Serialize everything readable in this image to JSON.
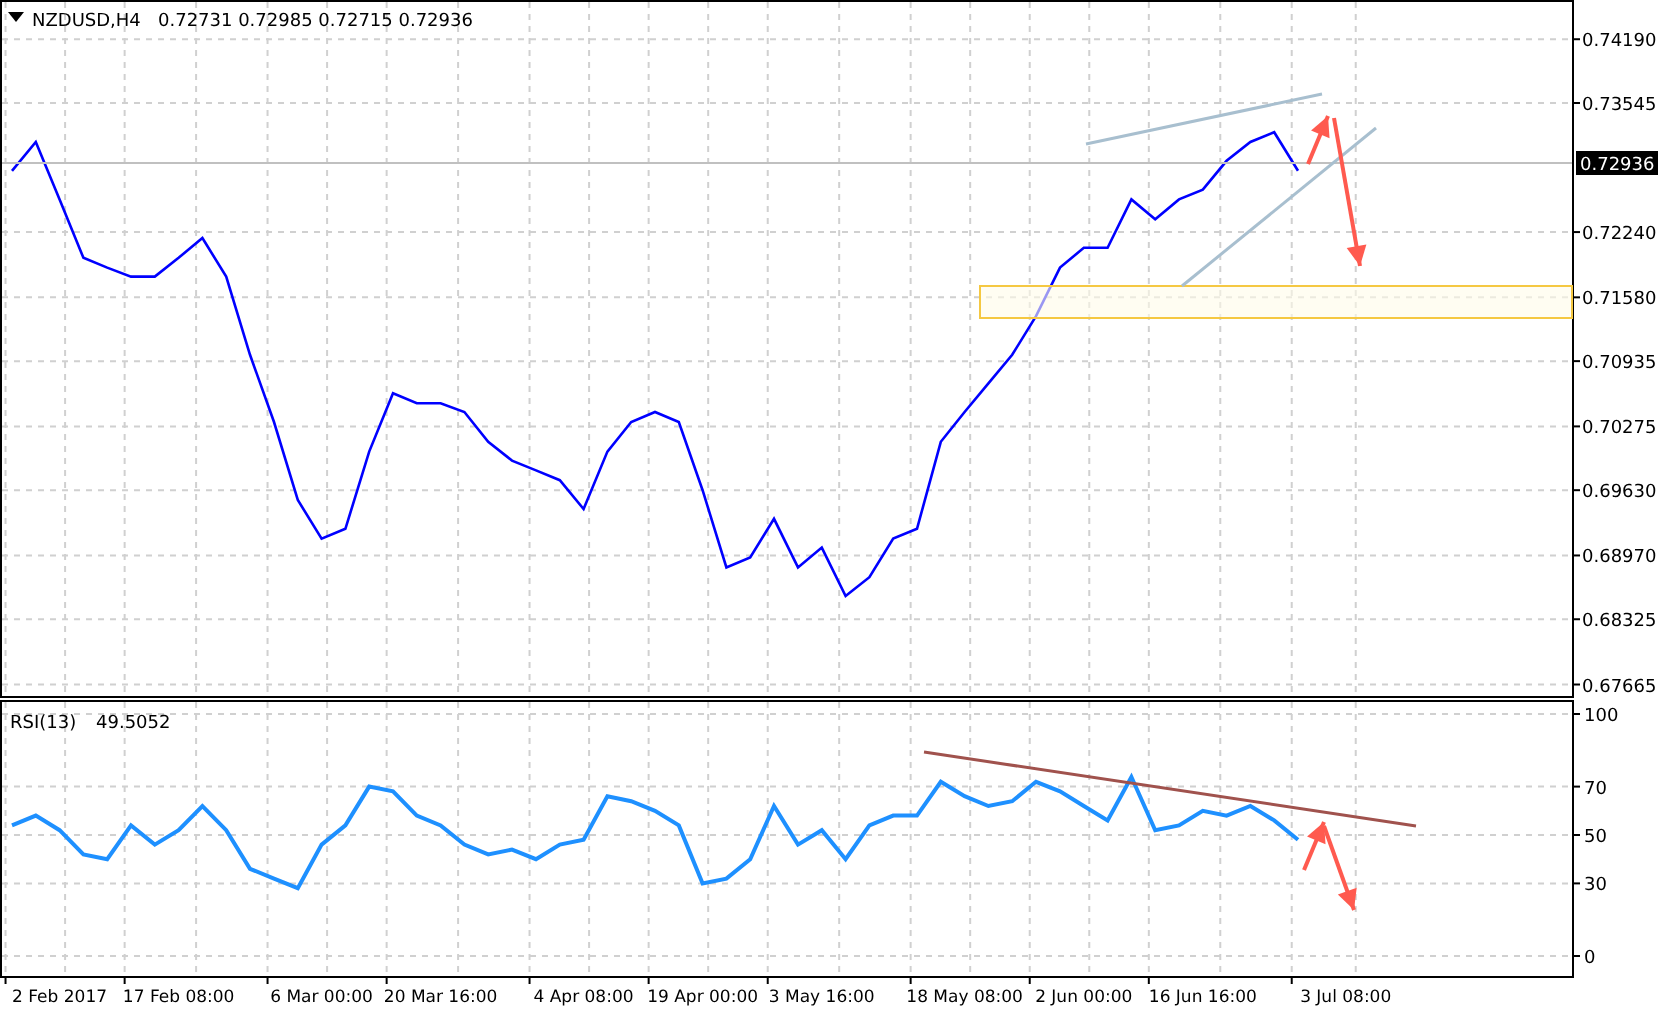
{
  "chart": {
    "ohlc": "0.72731 0.72985 0.72715 0.72936",
    "current_price": "0.72936",
    "chart_data": {
      "type": "line",
      "grid": true,
      "ylim": [
        0.6765,
        0.74526
      ],
      "yticks": [
        {
          "value": 0.7419,
          "label": "0.74190"
        },
        {
          "value": 0.73545,
          "label": "0.73545"
        },
        {
          "value": 0.7224,
          "label": "0.72240"
        },
        {
          "value": 0.7158,
          "label": "0.71580"
        },
        {
          "value": 0.70935,
          "label": "0.70935"
        },
        {
          "value": 0.70275,
          "label": "0.70275"
        },
        {
          "value": 0.6963,
          "label": "0.69630"
        },
        {
          "value": 0.6897,
          "label": "0.68970"
        },
        {
          "value": 0.68325,
          "label": "0.68325"
        },
        {
          "value": 0.67665,
          "label": "0.67665"
        }
      ],
      "series": [
        {
          "name": "NZDUSD,H4",
          "color": "#0000ff",
          "values": [
            0.7286,
            0.7315,
            0.7257,
            0.7198,
            0.7188,
            0.7179,
            0.7179,
            0.7198,
            0.7218,
            0.7179,
            0.71,
            0.7032,
            0.6953,
            0.6914,
            0.6924,
            0.7002,
            0.7061,
            0.7051,
            0.7051,
            0.7042,
            0.7012,
            0.6993,
            0.6983,
            0.6973,
            0.6944,
            0.7002,
            0.7032,
            0.7042,
            0.7032,
            0.6963,
            0.6885,
            0.6895,
            0.6934,
            0.6885,
            0.6905,
            0.6856,
            0.6875,
            0.6914,
            0.6924,
            0.7012,
            0.7042,
            0.7071,
            0.71,
            0.7139,
            0.7188,
            0.7208,
            0.7208,
            0.7257,
            0.7237,
            0.7257,
            0.7267,
            0.7296,
            0.7315,
            0.7325,
            0.7286,
            null,
            null,
            null,
            null,
            null,
            null,
            null,
            null,
            null,
            null,
            null
          ]
        }
      ]
    }
  },
  "rsi": {
    "reading": "49.5052",
    "chart_data": {
      "type": "line",
      "grid": true,
      "ylim": [
        0,
        100
      ],
      "categories": [
        null,
        null,
        "2 Feb 2017",
        null,
        null,
        null,
        null,
        "17 Feb 08:00",
        null,
        null,
        null,
        null,
        null,
        "6 Mar 00:00",
        null,
        null,
        null,
        null,
        "20 Mar 16:00",
        null,
        null,
        null,
        null,
        null,
        "4 Apr 08:00",
        null,
        null,
        null,
        null,
        "19 Apr 00:00",
        null,
        null,
        null,
        null,
        "3 May 16:00",
        null,
        null,
        null,
        null,
        null,
        "18 May 08:00",
        null,
        null,
        null,
        null,
        "2 Jun 00:00",
        null,
        null,
        null,
        null,
        "16 Jun 16:00",
        null,
        null,
        null,
        null,
        null,
        "3 Jul 08:00",
        null,
        null,
        null,
        null,
        null,
        null,
        null,
        null,
        null
      ],
      "yticks": [
        100,
        70,
        50,
        30,
        0
      ],
      "series": [
        {
          "name": "RSI(13)",
          "color": "#1e90ff",
          "values": [
            54,
            58,
            52,
            42,
            40,
            54,
            46,
            52,
            62,
            52,
            36,
            32,
            28,
            46,
            54,
            70,
            68,
            58,
            54,
            46,
            42,
            44,
            40,
            46,
            48,
            66,
            64,
            60,
            54,
            30,
            32,
            40,
            62,
            46,
            52,
            40,
            54,
            58,
            58,
            72,
            66,
            62,
            64,
            72,
            68,
            62,
            56,
            74,
            52,
            54,
            60,
            58,
            62,
            56,
            48,
            null,
            null,
            null,
            null,
            null,
            null,
            null,
            null,
            null,
            null,
            null
          ]
        }
      ]
    }
  }
}
